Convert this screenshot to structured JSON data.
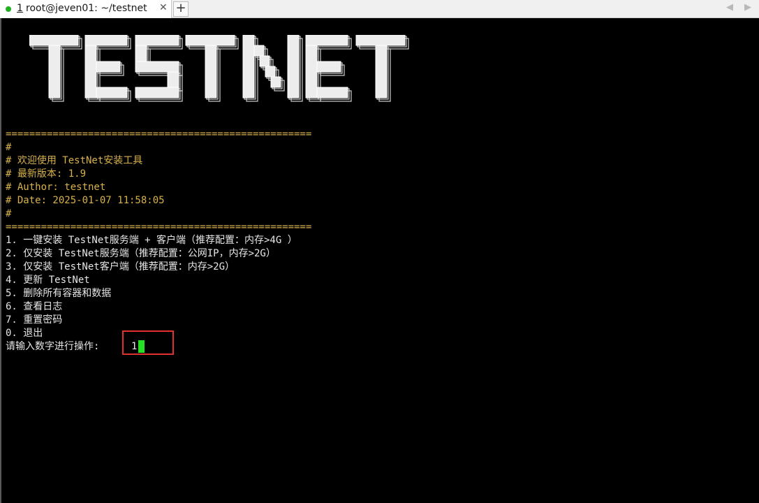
{
  "tab": {
    "number": "1",
    "title": "root@jeven01: ~/testnet",
    "close_label": "✕",
    "new_tab_label": "+",
    "status_color": "#20b020"
  },
  "terminal": {
    "banner_text": "TESTNET",
    "separator": "====================================================",
    "header_lines": [
      "#",
      "# 欢迎使用 TestNet安装工具",
      "# 最新版本: 1.9",
      "# Author: testnet",
      "# Date: 2025-01-07 11:58:05",
      "#"
    ],
    "menu_items": [
      "1. 一键安装 TestNet服务端 + 客户端（推荐配置：内存>4G ）",
      "2. 仅安装 TestNet服务端（推荐配置：公网IP，内存>2G）",
      "3. 仅安装 TestNet客户端（推荐配置：内存>2G）",
      "4. 更新 TestNet",
      "5. 删除所有容器和数据",
      "6. 查看日志",
      "7. 重置密码",
      "0. 退出"
    ],
    "prompt": "请输入数字进行操作:",
    "input_value": "1",
    "colors": {
      "header": "#d7b24a",
      "text": "#e6e6e6",
      "cursor": "#24e024",
      "highlight_box": "#e03030"
    }
  }
}
